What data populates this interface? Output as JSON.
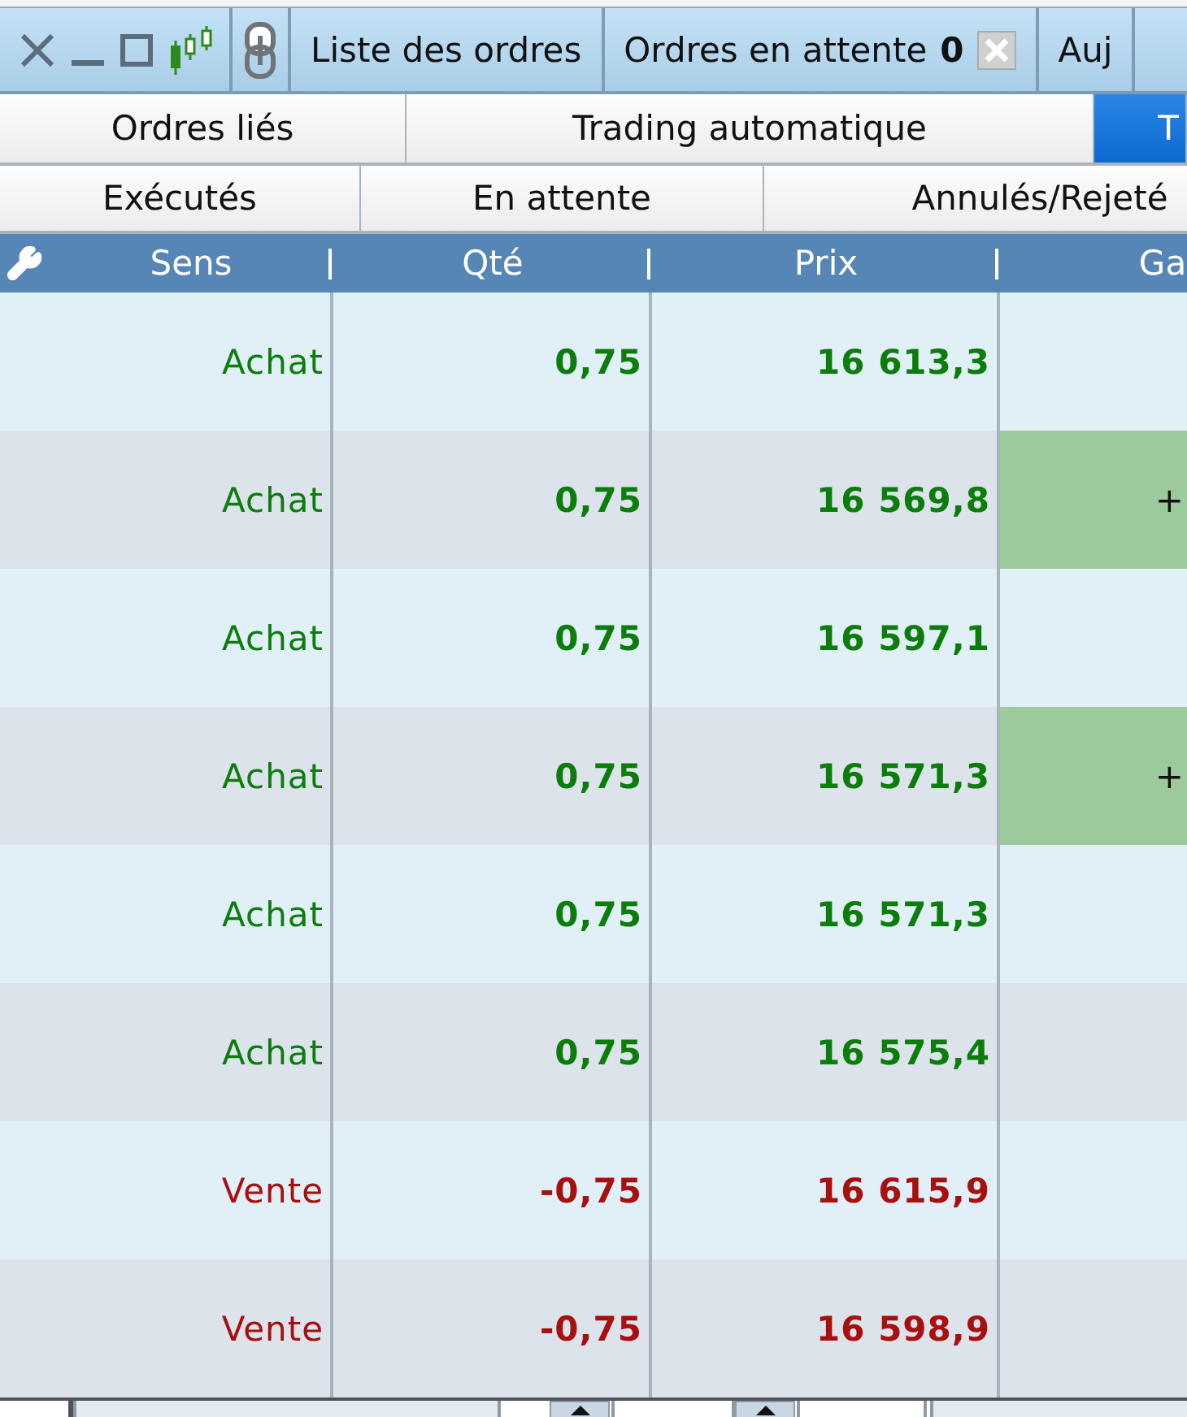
{
  "window": {
    "tabs": [
      {
        "label": "Liste des ordres",
        "selected": false
      },
      {
        "label": "Ordres en attente",
        "count": "0",
        "selected": false
      },
      {
        "label": "Auj",
        "selected": false
      }
    ]
  },
  "view_tabs": [
    {
      "label": "Ordres liés",
      "selected": false
    },
    {
      "label": "Trading automatique",
      "selected": false
    },
    {
      "label": "T",
      "selected": true
    }
  ],
  "filter_tabs": [
    {
      "label": "Exécutés",
      "selected": false
    },
    {
      "label": "En attente",
      "selected": false
    },
    {
      "label": "Annulés/Rejeté",
      "selected": false
    }
  ],
  "table": {
    "columns": [
      "Sens",
      "Qté",
      "Prix",
      "Ga"
    ],
    "rows": [
      {
        "kind": "buy",
        "side": "Achat",
        "qty": "0,75",
        "price": "16 613,3",
        "highlighted": false
      },
      {
        "kind": "buy",
        "side": "Achat",
        "qty": "0,75",
        "price": "16 569,8",
        "column_4": "+",
        "highlighted": true
      },
      {
        "kind": "buy",
        "side": "Achat",
        "qty": "0,75",
        "price": "16 597,1",
        "highlighted": false
      },
      {
        "kind": "buy",
        "side": "Achat",
        "qty": "0,75",
        "price": "16 571,3",
        "column_4": "+",
        "highlighted": true
      },
      {
        "kind": "buy",
        "side": "Achat",
        "qty": "0,75",
        "price": "16 571,3",
        "highlighted": false
      },
      {
        "kind": "buy",
        "side": "Achat",
        "qty": "0,75",
        "price": "16 575,4",
        "highlighted": false
      },
      {
        "kind": "sell",
        "side": "Vente",
        "qty": "-0,75",
        "price": "16 615,9",
        "highlighted": false
      },
      {
        "kind": "sell",
        "side": "Vente",
        "qty": "-0,75",
        "price": "16 598,9",
        "highlighted": false
      }
    ]
  }
}
